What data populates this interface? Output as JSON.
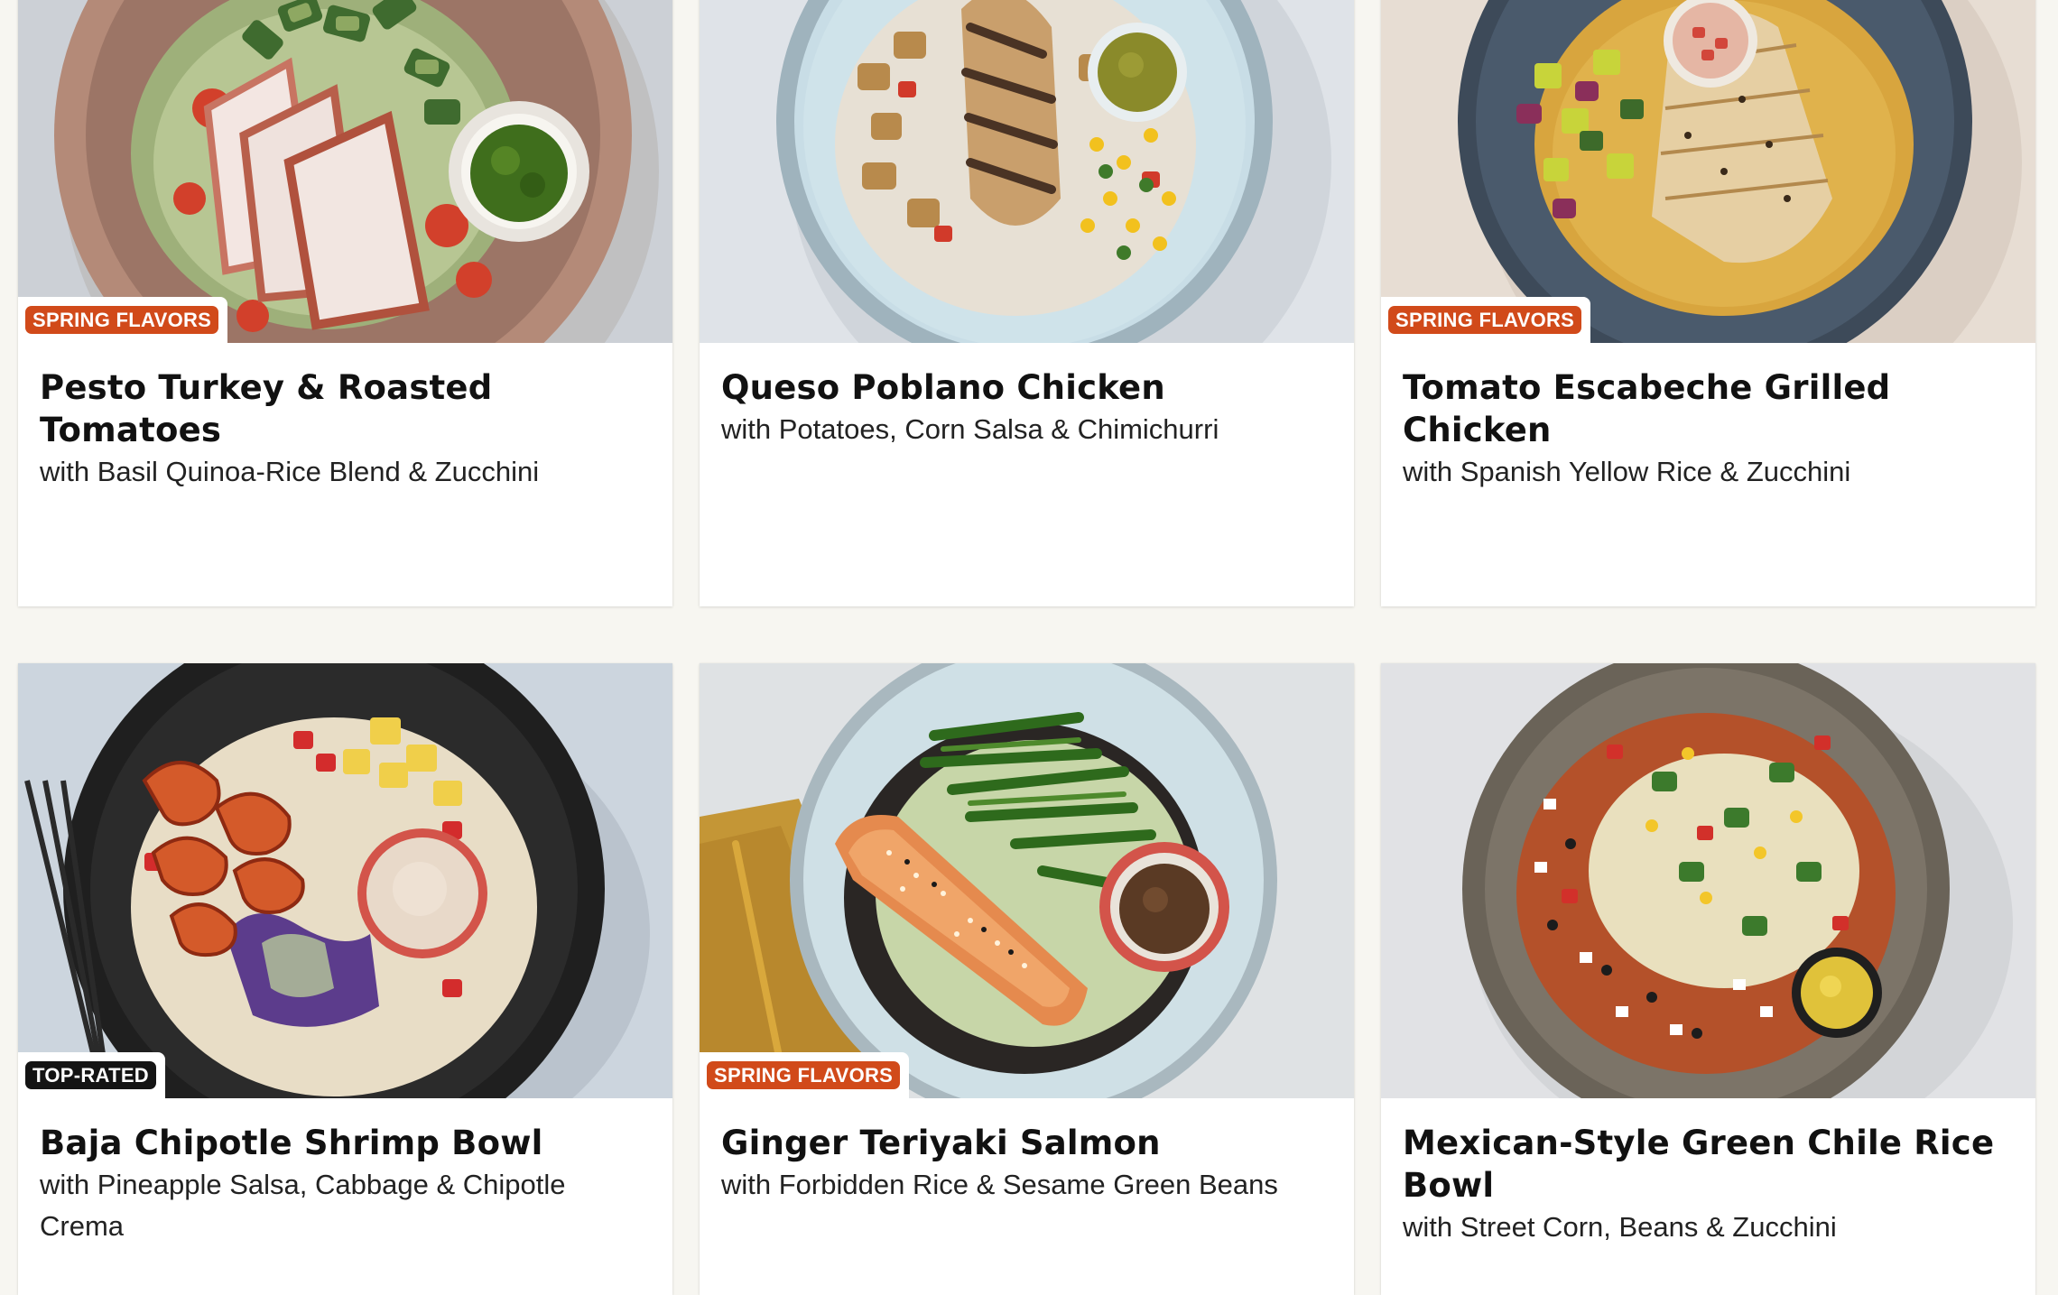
{
  "colors": {
    "page_background": "#f7f6f1",
    "card_background": "#ffffff",
    "badge_spring": "#d14a1a",
    "badge_toprated": "#141414",
    "title_text": "#111111"
  },
  "meals": [
    {
      "title": "Pesto Turkey & Roasted Tomatoes",
      "subtitle": "with Basil Quinoa-Rice Blend & Zucchini",
      "badge": "SPRING FLAVORS",
      "badge_kind": "spring",
      "image_icon": "meal-photo"
    },
    {
      "title": "Queso Poblano Chicken",
      "subtitle": "with Potatoes, Corn Salsa & Chimichurri",
      "badge": "",
      "badge_kind": "none",
      "image_icon": "meal-photo"
    },
    {
      "title": "Tomato Escabeche Grilled Chicken",
      "subtitle": "with Spanish Yellow Rice & Zucchini",
      "badge": "SPRING FLAVORS",
      "badge_kind": "spring",
      "image_icon": "meal-photo"
    },
    {
      "title": "Baja Chipotle Shrimp Bowl",
      "subtitle": "with Pineapple Salsa, Cabbage & Chipotle Crema",
      "badge": "TOP-RATED",
      "badge_kind": "toprated",
      "image_icon": "meal-photo"
    },
    {
      "title": "Ginger Teriyaki Salmon",
      "subtitle": "with Forbidden Rice & Sesame Green Beans",
      "badge": "SPRING FLAVORS",
      "badge_kind": "spring",
      "image_icon": "meal-photo"
    },
    {
      "title": "Mexican-Style Green Chile Rice Bowl",
      "subtitle": "with Street Corn, Beans & Zucchini",
      "badge": "",
      "badge_kind": "none",
      "image_icon": "meal-photo"
    }
  ]
}
